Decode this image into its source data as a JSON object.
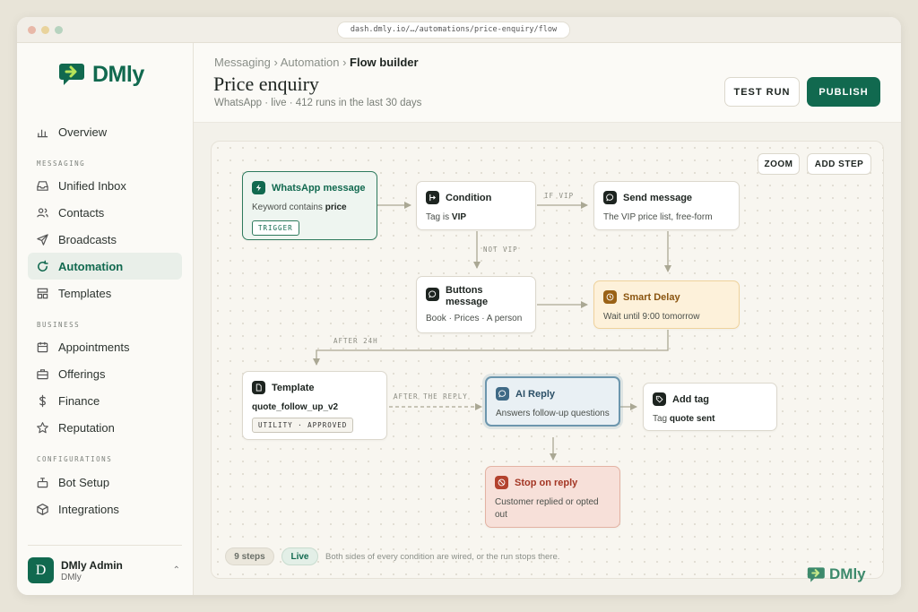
{
  "browser": {
    "url": "dash.dmly.io/…/automations/price-enquiry/flow"
  },
  "brand": {
    "name": "DMly",
    "color": "#11694f"
  },
  "sidebar": {
    "overview": "Overview",
    "sections": {
      "messaging": "MESSAGING",
      "business": "BUSINESS",
      "configurations": "CONFIGURATIONS"
    },
    "items": {
      "inbox": "Unified Inbox",
      "contacts": "Contacts",
      "broadcasts": "Broadcasts",
      "automation": "Automation",
      "templates": "Templates",
      "appointments": "Appointments",
      "offerings": "Offerings",
      "finance": "Finance",
      "reputation": "Reputation",
      "bot_setup": "Bot Setup",
      "integrations": "Integrations"
    },
    "active_item": "Automation",
    "user": {
      "initial": "D",
      "name": "DMly Admin",
      "org": "DMly"
    }
  },
  "header": {
    "breadcrumb": [
      "Messaging ›",
      "Automation ›",
      "Flow builder"
    ],
    "title": "Price enquiry",
    "subtitle": "WhatsApp · live · 412 runs in the last 30 days",
    "test_run": "TEST RUN",
    "publish": "PUBLISH"
  },
  "canvas": {
    "zoom": "ZOOM",
    "add_step": "ADD STEP",
    "nodes": {
      "trigger": {
        "title": "WhatsApp message",
        "body_prefix": "Keyword contains ",
        "body_strong": "price",
        "tag": "TRIGGER"
      },
      "condition": {
        "title": "Condition",
        "body_prefix": "Tag is ",
        "body_strong": "VIP"
      },
      "send": {
        "title": "Send message",
        "body": "The VIP price list, free-form"
      },
      "buttons": {
        "title": "Buttons message",
        "body": "Book · Prices · A person"
      },
      "delay": {
        "title": "Smart Delay",
        "body": "Wait until 9:00 tomorrow"
      },
      "template": {
        "title": "Template",
        "body_strong": "quote_follow_up_v2",
        "tag": "UTILITY · APPROVED"
      },
      "ai": {
        "title": "AI Reply",
        "body": "Answers follow-up questions"
      },
      "addtag": {
        "title": "Add tag",
        "body_prefix": "Tag ",
        "body_strong": "quote sent"
      },
      "stop": {
        "title": "Stop on reply",
        "body": "Customer replied or opted out"
      }
    },
    "edges": {
      "if_vip": "IF VIP",
      "not_vip": "NOT VIP",
      "after_24h": "AFTER 24H",
      "after_reply": "AFTER THE REPLY"
    },
    "footer": {
      "steps": "9 steps",
      "live": "Live",
      "note": "Both sides of every condition are wired, or the run stops there."
    }
  }
}
